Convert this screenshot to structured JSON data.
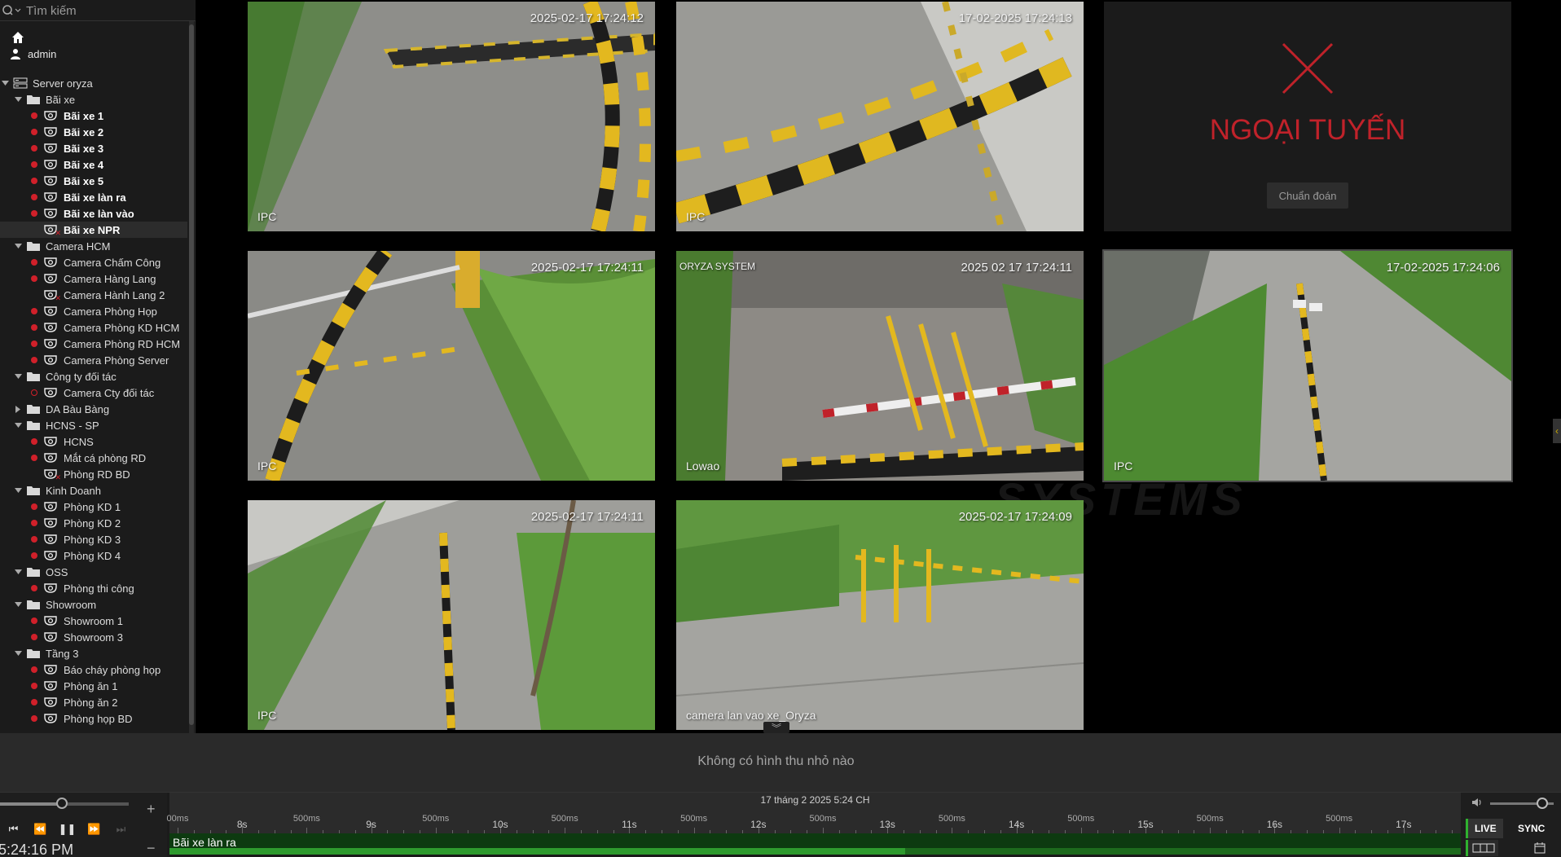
{
  "search": {
    "placeholder": "Tìm kiếm"
  },
  "user": {
    "name": "admin"
  },
  "colors": {
    "status_red": "#d0202a",
    "live_green": "#2fb12f",
    "offline_red": "#c0222a",
    "record_green": "#2e9a2e"
  },
  "tree": [
    {
      "level": 0,
      "type": "server",
      "label": "Server oryza",
      "expanded": true
    },
    {
      "level": 1,
      "type": "folder",
      "label": "Bãi xe",
      "expanded": true
    },
    {
      "level": 2,
      "type": "camera",
      "label": "Bãi xe 1",
      "status": "on",
      "strong": true
    },
    {
      "level": 2,
      "type": "camera",
      "label": "Bãi xe 2",
      "status": "on",
      "strong": true
    },
    {
      "level": 2,
      "type": "camera",
      "label": "Bãi xe 3",
      "status": "on",
      "strong": true
    },
    {
      "level": 2,
      "type": "camera",
      "label": "Bãi xe 4",
      "status": "on",
      "strong": true
    },
    {
      "level": 2,
      "type": "camera",
      "label": "Bãi xe 5",
      "status": "on",
      "strong": true
    },
    {
      "level": 2,
      "type": "camera",
      "label": "Bãi xe làn ra",
      "status": "on",
      "strong": true
    },
    {
      "level": 2,
      "type": "camera",
      "label": "Bãi xe làn vào",
      "status": "on",
      "strong": true
    },
    {
      "level": 2,
      "type": "camera",
      "label": "Bãi xe NPR",
      "status": "none",
      "error": true,
      "strong": true,
      "selected": true
    },
    {
      "level": 1,
      "type": "folder",
      "label": "Camera HCM",
      "expanded": true
    },
    {
      "level": 2,
      "type": "camera",
      "label": "Camera Chấm Công",
      "status": "on"
    },
    {
      "level": 2,
      "type": "camera",
      "label": "Camera Hàng Lang",
      "status": "on"
    },
    {
      "level": 2,
      "type": "camera",
      "label": "Camera Hành Lang 2",
      "status": "none",
      "error": true
    },
    {
      "level": 2,
      "type": "camera",
      "label": "Camera Phòng Họp",
      "status": "on"
    },
    {
      "level": 2,
      "type": "camera",
      "label": "Camera Phòng KD HCM",
      "status": "on"
    },
    {
      "level": 2,
      "type": "camera",
      "label": "Camera Phòng RD HCM",
      "status": "on"
    },
    {
      "level": 2,
      "type": "camera",
      "label": "Camera Phòng Server",
      "status": "on"
    },
    {
      "level": 1,
      "type": "folder",
      "label": "Công ty đối tác",
      "expanded": true
    },
    {
      "level": 2,
      "type": "camera",
      "label": "Camera Cty đối tác",
      "status": "hollow"
    },
    {
      "level": 1,
      "type": "folder",
      "label": "DA Bàu Bàng",
      "expanded": false
    },
    {
      "level": 1,
      "type": "folder",
      "label": "HCNS - SP",
      "expanded": true
    },
    {
      "level": 2,
      "type": "camera",
      "label": "HCNS",
      "status": "on"
    },
    {
      "level": 2,
      "type": "camera",
      "label": "Mắt cá phòng RD",
      "status": "on"
    },
    {
      "level": 2,
      "type": "camera",
      "label": "Phòng RD BD",
      "status": "none",
      "error": true
    },
    {
      "level": 1,
      "type": "folder",
      "label": "Kinh Doanh",
      "expanded": true
    },
    {
      "level": 2,
      "type": "camera",
      "label": "Phòng KD 1",
      "status": "on"
    },
    {
      "level": 2,
      "type": "camera",
      "label": "Phòng KD 2",
      "status": "on"
    },
    {
      "level": 2,
      "type": "camera",
      "label": "Phòng KD 3",
      "status": "on"
    },
    {
      "level": 2,
      "type": "camera",
      "label": "Phòng KD 4",
      "status": "on"
    },
    {
      "level": 1,
      "type": "folder",
      "label": "OSS",
      "expanded": true
    },
    {
      "level": 2,
      "type": "camera",
      "label": "Phòng thi công",
      "status": "on"
    },
    {
      "level": 1,
      "type": "folder",
      "label": "Showroom",
      "expanded": true
    },
    {
      "level": 2,
      "type": "camera",
      "label": "Showroom 1",
      "status": "on"
    },
    {
      "level": 2,
      "type": "camera",
      "label": "Showroom 3",
      "status": "on"
    },
    {
      "level": 1,
      "type": "folder",
      "label": "Tầng 3",
      "expanded": true
    },
    {
      "level": 2,
      "type": "camera",
      "label": "Báo cháy phòng họp",
      "status": "on"
    },
    {
      "level": 2,
      "type": "camera",
      "label": "Phòng ăn 1",
      "status": "on"
    },
    {
      "level": 2,
      "type": "camera",
      "label": "Phòng ăn 2",
      "status": "on"
    },
    {
      "level": 2,
      "type": "camera",
      "label": "Phòng họp BD",
      "status": "on"
    }
  ],
  "grid": {
    "watermark": "SYSTEMS",
    "tiles": [
      {
        "stamp": "2025-02-17 17:24:12",
        "corner": "IPC",
        "scene": "ramp"
      },
      {
        "stamp": "17-02-2025 17:24:13",
        "corner": "IPC",
        "scene": "wall"
      },
      {
        "offline": true,
        "offline_text": "NGOẠI TUYẾN",
        "diag_label": "Chuẩn đoán"
      },
      {
        "stamp": "2025-02-17 17:24:11",
        "corner": "IPC",
        "scene": "bushes"
      },
      {
        "stamp": "2025 02 17 17:24:11",
        "corner": "Lowao",
        "topleft": "ORYZA SYSTEM",
        "scene": "gate"
      },
      {
        "stamp": "17-02-2025 17:24:06",
        "corner": "IPC",
        "scene": "path",
        "active": true
      },
      {
        "stamp": "2025-02-17 17:24:11",
        "corner": "IPC",
        "scene": "barrier"
      },
      {
        "stamp": "2025-02-17 17:24:09",
        "corner": "camera lan vao xe_Oryza",
        "scene": "fence"
      }
    ]
  },
  "thumbnails": {
    "empty_message": "Không có hình thu nhỏ nào"
  },
  "playback": {
    "clock": "5:24:16 PM",
    "speed_level": 0.48,
    "volume_level": 0.82,
    "buttons": [
      "skip-back",
      "rewind",
      "pause",
      "step-forward",
      "skip-forward"
    ]
  },
  "timeline": {
    "date_label": "17 tháng 2 2025 5:24 CH",
    "labels": [
      "00ms",
      "8s",
      "500ms",
      "9s",
      "500ms",
      "10s",
      "500ms",
      "11s",
      "500ms",
      "12s",
      "500ms",
      "13s",
      "500ms",
      "14s",
      "500ms",
      "15s",
      "500ms",
      "16s",
      "500ms",
      "17s"
    ],
    "track_name": "Bãi xe làn ra",
    "recorded_fraction": 0.57
  },
  "controls": {
    "live_label": "LIVE",
    "sync_label": "SYNC"
  }
}
